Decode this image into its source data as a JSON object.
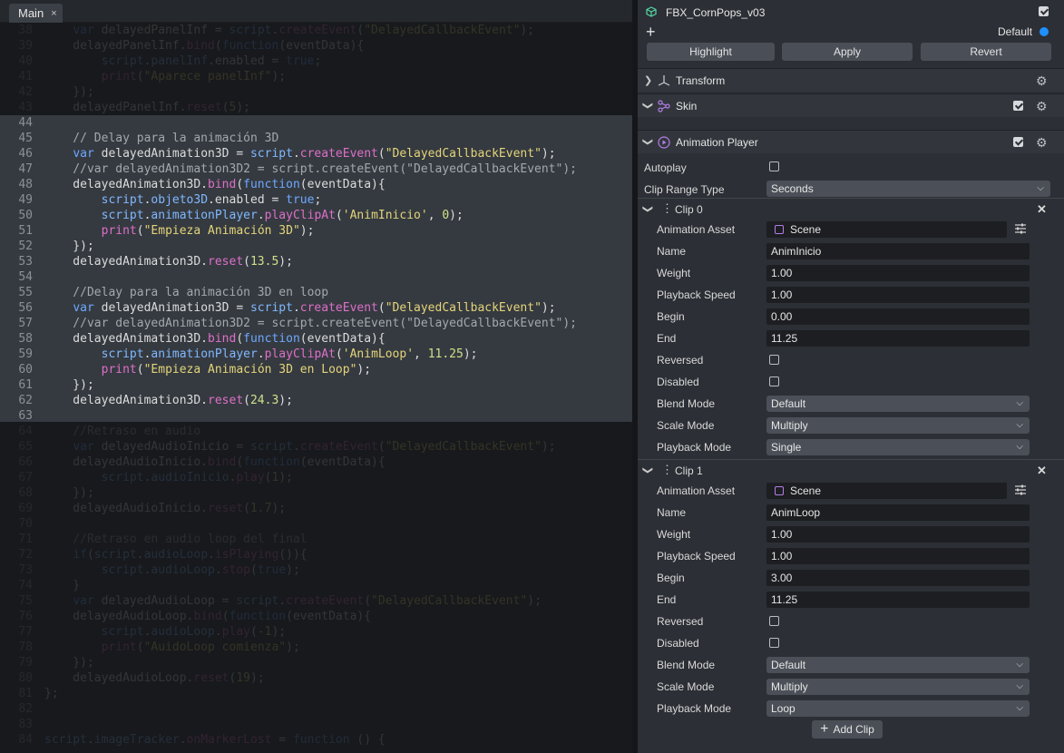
{
  "editor": {
    "tab_label": "Main",
    "tab_close_glyph": "×",
    "lines": [
      {
        "n": "38",
        "tokens": [
          [
            "    ",
            "pl"
          ],
          [
            "var",
            "kw"
          ],
          [
            " delayedPanelInf = ",
            "pl"
          ],
          [
            "script",
            "prop"
          ],
          [
            ".",
            "pl"
          ],
          [
            "createEvent",
            "fn"
          ],
          [
            "(",
            "pl"
          ],
          [
            "\"DelayedCallbackEvent\"",
            "str"
          ],
          [
            ");",
            "pl"
          ]
        ]
      },
      {
        "n": "39",
        "tokens": [
          [
            "    delayedPanelInf.",
            "pl"
          ],
          [
            "bind",
            "fn"
          ],
          [
            "(",
            "pl"
          ],
          [
            "function",
            "kw"
          ],
          [
            "(eventData){",
            "pl"
          ]
        ]
      },
      {
        "n": "40",
        "tokens": [
          [
            "        ",
            "pl"
          ],
          [
            "script",
            "prop"
          ],
          [
            ".",
            "pl"
          ],
          [
            "panelInf",
            "prop"
          ],
          [
            ".enabled = ",
            "pl"
          ],
          [
            "true",
            "kw"
          ],
          [
            ";",
            "pl"
          ]
        ]
      },
      {
        "n": "41",
        "tokens": [
          [
            "        ",
            "pl"
          ],
          [
            "print",
            "fn"
          ],
          [
            "(",
            "pl"
          ],
          [
            "\"Aparece panelInf\"",
            "str"
          ],
          [
            ");",
            "pl"
          ]
        ]
      },
      {
        "n": "42",
        "tokens": [
          [
            "    });",
            "pl"
          ]
        ]
      },
      {
        "n": "43",
        "tokens": [
          [
            "    delayedPanelInf.",
            "pl"
          ],
          [
            "reset",
            "fn"
          ],
          [
            "(",
            "pl"
          ],
          [
            "5",
            "num"
          ],
          [
            ");",
            "pl"
          ]
        ]
      },
      {
        "n": "44",
        "tokens": [
          [
            "",
            "pl"
          ]
        ]
      },
      {
        "n": "45",
        "tokens": [
          [
            "    // Delay para la animación 3D",
            "cm"
          ]
        ]
      },
      {
        "n": "46",
        "tokens": [
          [
            "    ",
            "pl"
          ],
          [
            "var",
            "kw"
          ],
          [
            " delayedAnimation3D = ",
            "pl"
          ],
          [
            "script",
            "prop"
          ],
          [
            ".",
            "pl"
          ],
          [
            "createEvent",
            "fn"
          ],
          [
            "(",
            "pl"
          ],
          [
            "\"DelayedCallbackEvent\"",
            "str"
          ],
          [
            ");",
            "pl"
          ]
        ]
      },
      {
        "n": "47",
        "tokens": [
          [
            "    //var delayedAnimation3D2 = script.createEvent(\"DelayedCallbackEvent\");",
            "cm"
          ]
        ]
      },
      {
        "n": "48",
        "tokens": [
          [
            "    delayedAnimation3D.",
            "pl"
          ],
          [
            "bind",
            "fn"
          ],
          [
            "(",
            "pl"
          ],
          [
            "function",
            "kw"
          ],
          [
            "(eventData){",
            "pl"
          ]
        ]
      },
      {
        "n": "49",
        "tokens": [
          [
            "        ",
            "pl"
          ],
          [
            "script",
            "prop"
          ],
          [
            ".",
            "pl"
          ],
          [
            "objeto3D",
            "prop"
          ],
          [
            ".enabled = ",
            "pl"
          ],
          [
            "true",
            "kw"
          ],
          [
            ";",
            "pl"
          ]
        ]
      },
      {
        "n": "50",
        "tokens": [
          [
            "        ",
            "pl"
          ],
          [
            "script",
            "prop"
          ],
          [
            ".",
            "pl"
          ],
          [
            "animationPlayer",
            "prop"
          ],
          [
            ".",
            "pl"
          ],
          [
            "playClipAt",
            "fn"
          ],
          [
            "(",
            "pl"
          ],
          [
            "'AnimInicio'",
            "str"
          ],
          [
            ", ",
            "pl"
          ],
          [
            "0",
            "num"
          ],
          [
            ");",
            "pl"
          ]
        ]
      },
      {
        "n": "51",
        "tokens": [
          [
            "        ",
            "pl"
          ],
          [
            "print",
            "fn"
          ],
          [
            "(",
            "pl"
          ],
          [
            "\"Empieza Animación 3D\"",
            "str"
          ],
          [
            ");",
            "pl"
          ]
        ]
      },
      {
        "n": "52",
        "tokens": [
          [
            "    });",
            "pl"
          ]
        ]
      },
      {
        "n": "53",
        "tokens": [
          [
            "    delayedAnimation3D.",
            "pl"
          ],
          [
            "reset",
            "fn"
          ],
          [
            "(",
            "pl"
          ],
          [
            "13.5",
            "num"
          ],
          [
            ");",
            "pl"
          ]
        ]
      },
      {
        "n": "54",
        "tokens": [
          [
            "",
            "pl"
          ]
        ]
      },
      {
        "n": "55",
        "tokens": [
          [
            "    //Delay para la animación 3D en loop",
            "cm"
          ]
        ]
      },
      {
        "n": "56",
        "tokens": [
          [
            "    ",
            "pl"
          ],
          [
            "var",
            "kw"
          ],
          [
            " delayedAnimation3D = ",
            "pl"
          ],
          [
            "script",
            "prop"
          ],
          [
            ".",
            "pl"
          ],
          [
            "createEvent",
            "fn"
          ],
          [
            "(",
            "pl"
          ],
          [
            "\"DelayedCallbackEvent\"",
            "str"
          ],
          [
            ");",
            "pl"
          ]
        ]
      },
      {
        "n": "57",
        "tokens": [
          [
            "    //var delayedAnimation3D2 = script.createEvent(\"DelayedCallbackEvent\");",
            "cm"
          ]
        ]
      },
      {
        "n": "58",
        "tokens": [
          [
            "    delayedAnimation3D.",
            "pl"
          ],
          [
            "bind",
            "fn"
          ],
          [
            "(",
            "pl"
          ],
          [
            "function",
            "kw"
          ],
          [
            "(eventData){",
            "pl"
          ]
        ]
      },
      {
        "n": "59",
        "tokens": [
          [
            "        ",
            "pl"
          ],
          [
            "script",
            "prop"
          ],
          [
            ".",
            "pl"
          ],
          [
            "animationPlayer",
            "prop"
          ],
          [
            ".",
            "pl"
          ],
          [
            "playClipAt",
            "fn"
          ],
          [
            "(",
            "pl"
          ],
          [
            "'AnimLoop'",
            "str"
          ],
          [
            ", ",
            "pl"
          ],
          [
            "11.25",
            "num"
          ],
          [
            ");",
            "pl"
          ]
        ]
      },
      {
        "n": "60",
        "tokens": [
          [
            "        ",
            "pl"
          ],
          [
            "print",
            "fn"
          ],
          [
            "(",
            "pl"
          ],
          [
            "\"Empieza Animación 3D en Loop\"",
            "str"
          ],
          [
            ");",
            "pl"
          ]
        ]
      },
      {
        "n": "61",
        "tokens": [
          [
            "    });",
            "pl"
          ]
        ]
      },
      {
        "n": "62",
        "tokens": [
          [
            "    delayedAnimation3D.",
            "pl"
          ],
          [
            "reset",
            "fn"
          ],
          [
            "(",
            "pl"
          ],
          [
            "24.3",
            "num"
          ],
          [
            ");",
            "pl"
          ]
        ]
      },
      {
        "n": "63",
        "tokens": [
          [
            "",
            "pl"
          ]
        ]
      },
      {
        "n": "64",
        "tokens": [
          [
            "    //Retraso en audio",
            "cm"
          ]
        ]
      },
      {
        "n": "65",
        "tokens": [
          [
            "    ",
            "pl"
          ],
          [
            "var",
            "kw"
          ],
          [
            " delayedAudioInicio = ",
            "pl"
          ],
          [
            "script",
            "prop"
          ],
          [
            ".",
            "pl"
          ],
          [
            "createEvent",
            "fn"
          ],
          [
            "(",
            "pl"
          ],
          [
            "\"DelayedCallbackEvent\"",
            "str"
          ],
          [
            ");",
            "pl"
          ]
        ]
      },
      {
        "n": "66",
        "tokens": [
          [
            "    delayedAudioInicio.",
            "pl"
          ],
          [
            "bind",
            "fn"
          ],
          [
            "(",
            "pl"
          ],
          [
            "function",
            "kw"
          ],
          [
            "(eventData){",
            "pl"
          ]
        ]
      },
      {
        "n": "67",
        "tokens": [
          [
            "        ",
            "pl"
          ],
          [
            "script",
            "prop"
          ],
          [
            ".",
            "pl"
          ],
          [
            "audioInicio",
            "prop"
          ],
          [
            ".",
            "pl"
          ],
          [
            "play",
            "fn"
          ],
          [
            "(",
            "pl"
          ],
          [
            "1",
            "num"
          ],
          [
            ");",
            "pl"
          ]
        ]
      },
      {
        "n": "68",
        "tokens": [
          [
            "    });",
            "pl"
          ]
        ]
      },
      {
        "n": "69",
        "tokens": [
          [
            "    delayedAudioInicio.",
            "pl"
          ],
          [
            "reset",
            "fn"
          ],
          [
            "(",
            "pl"
          ],
          [
            "1.7",
            "num"
          ],
          [
            ");",
            "pl"
          ]
        ]
      },
      {
        "n": "70",
        "tokens": [
          [
            "",
            "pl"
          ]
        ]
      },
      {
        "n": "71",
        "tokens": [
          [
            "    //Retraso en audio loop del final",
            "cm"
          ]
        ]
      },
      {
        "n": "72",
        "tokens": [
          [
            "    ",
            "pl"
          ],
          [
            "if",
            "kw"
          ],
          [
            "(",
            "pl"
          ],
          [
            "script",
            "prop"
          ],
          [
            ".",
            "pl"
          ],
          [
            "audioLoop",
            "prop"
          ],
          [
            ".",
            "pl"
          ],
          [
            "isPlaying",
            "fn"
          ],
          [
            "()){",
            "pl"
          ]
        ]
      },
      {
        "n": "73",
        "tokens": [
          [
            "        ",
            "pl"
          ],
          [
            "script",
            "prop"
          ],
          [
            ".",
            "pl"
          ],
          [
            "audioLoop",
            "prop"
          ],
          [
            ".",
            "pl"
          ],
          [
            "stop",
            "fn"
          ],
          [
            "(",
            "pl"
          ],
          [
            "true",
            "kw"
          ],
          [
            ");",
            "pl"
          ]
        ]
      },
      {
        "n": "74",
        "tokens": [
          [
            "    }",
            "pl"
          ]
        ]
      },
      {
        "n": "75",
        "tokens": [
          [
            "    ",
            "pl"
          ],
          [
            "var",
            "kw"
          ],
          [
            " delayedAudioLoop = ",
            "pl"
          ],
          [
            "script",
            "prop"
          ],
          [
            ".",
            "pl"
          ],
          [
            "createEvent",
            "fn"
          ],
          [
            "(",
            "pl"
          ],
          [
            "\"DelayedCallbackEvent\"",
            "str"
          ],
          [
            ");",
            "pl"
          ]
        ]
      },
      {
        "n": "76",
        "tokens": [
          [
            "    delayedAudioLoop.",
            "pl"
          ],
          [
            "bind",
            "fn"
          ],
          [
            "(",
            "pl"
          ],
          [
            "function",
            "kw"
          ],
          [
            "(eventData){",
            "pl"
          ]
        ]
      },
      {
        "n": "77",
        "tokens": [
          [
            "        ",
            "pl"
          ],
          [
            "script",
            "prop"
          ],
          [
            ".",
            "pl"
          ],
          [
            "audioLoop",
            "prop"
          ],
          [
            ".",
            "pl"
          ],
          [
            "play",
            "fn"
          ],
          [
            "(",
            "pl"
          ],
          [
            "-1",
            "num"
          ],
          [
            ");",
            "pl"
          ]
        ]
      },
      {
        "n": "78",
        "tokens": [
          [
            "        ",
            "pl"
          ],
          [
            "print",
            "fn"
          ],
          [
            "(",
            "pl"
          ],
          [
            "\"AuidoLoop comienza\"",
            "str"
          ],
          [
            ");",
            "pl"
          ]
        ]
      },
      {
        "n": "79",
        "tokens": [
          [
            "    });",
            "pl"
          ]
        ]
      },
      {
        "n": "80",
        "tokens": [
          [
            "    delayedAudioLoop.",
            "pl"
          ],
          [
            "reset",
            "fn"
          ],
          [
            "(",
            "pl"
          ],
          [
            "19",
            "num"
          ],
          [
            ");",
            "pl"
          ]
        ]
      },
      {
        "n": "81",
        "tokens": [
          [
            "};",
            "pl"
          ]
        ]
      },
      {
        "n": "82",
        "tokens": [
          [
            "",
            "pl"
          ]
        ]
      },
      {
        "n": "83",
        "tokens": [
          [
            "",
            "pl"
          ]
        ]
      },
      {
        "n": "84",
        "tokens": [
          [
            "script",
            "prop"
          ],
          [
            ".",
            "pl"
          ],
          [
            "imageTracker",
            "prop"
          ],
          [
            ".",
            "pl"
          ],
          [
            "onMarkerLost",
            "fn"
          ],
          [
            " = ",
            "pl"
          ],
          [
            "function",
            "kw"
          ],
          [
            " () {",
            "pl"
          ]
        ]
      }
    ]
  },
  "inspector": {
    "object_name": "FBX_CornPops_v03",
    "add_glyph": "+",
    "layer_label": "Default",
    "accent_color": "#1e90ff",
    "buttons": {
      "highlight": "Highlight",
      "apply": "Apply",
      "revert": "Revert"
    },
    "sections": {
      "transform": "Transform",
      "skin": "Skin",
      "animation_player": "Animation Player"
    },
    "autoplay_label": "Autoplay",
    "clip_range_label": "Clip Range Type",
    "clip_range_value": "Seconds",
    "labels": {
      "animation_asset": "Animation Asset",
      "name": "Name",
      "weight": "Weight",
      "playback_speed": "Playback Speed",
      "begin": "Begin",
      "end": "End",
      "reversed": "Reversed",
      "disabled": "Disabled",
      "blend_mode": "Blend Mode",
      "scale_mode": "Scale Mode",
      "playback_mode": "Playback Mode"
    },
    "clips": [
      {
        "title": "Clip 0",
        "asset": "Scene",
        "name": "AnimInicio",
        "weight": "1.00",
        "speed": "1.00",
        "begin": "0.00",
        "end": "11.25",
        "blend": "Default",
        "scale": "Multiply",
        "playback": "Single"
      },
      {
        "title": "Clip 1",
        "asset": "Scene",
        "name": "AnimLoop",
        "weight": "1.00",
        "speed": "1.00",
        "begin": "3.00",
        "end": "11.25",
        "blend": "Default",
        "scale": "Multiply",
        "playback": "Loop"
      }
    ],
    "add_clip_label": "Add Clip",
    "add_clip_glyph": "+"
  }
}
